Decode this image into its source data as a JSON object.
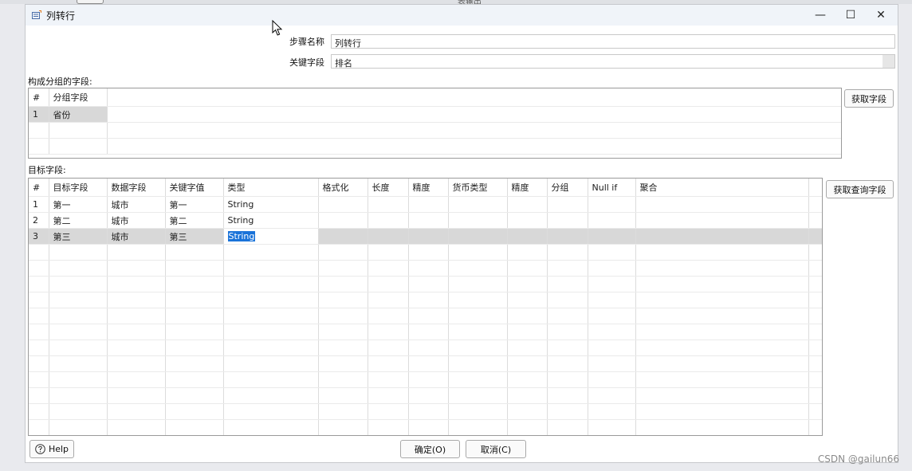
{
  "window": {
    "title": "列转行",
    "minimize_glyph": "—",
    "maximize_glyph": "☐",
    "close_glyph": "✕"
  },
  "background_label": "表输出",
  "form": {
    "step_name_label": "步骤名称",
    "step_name_value": "列转行",
    "key_field_label": "关键字段",
    "key_field_value": "排名"
  },
  "group_section": {
    "label": "构成分组的字段:",
    "header_idx": "#",
    "header_field": "分组字段",
    "rows": [
      {
        "idx": "1",
        "field": "省份"
      }
    ],
    "get_fields_button": "获取字段"
  },
  "target_section": {
    "label": "目标字段:",
    "headers": [
      "#",
      "目标字段",
      "数据字段",
      "关键字值",
      "类型",
      "格式化",
      "长度",
      "精度",
      "货币类型",
      "精度",
      "分组",
      "Null if",
      "聚合"
    ],
    "rows": [
      [
        "1",
        "第一",
        "城市",
        "第一",
        "String",
        "",
        "",
        "",
        "",
        "",
        "",
        "",
        ""
      ],
      [
        "2",
        "第二",
        "城市",
        "第二",
        "String",
        "",
        "",
        "",
        "",
        "",
        "",
        "",
        ""
      ],
      [
        "3",
        "第三",
        "城市",
        "第三",
        "String",
        "",
        "",
        "",
        "",
        "",
        "",
        "",
        ""
      ]
    ],
    "get_lookup_fields_button": "获取查询字段"
  },
  "footer": {
    "help_label": "Help",
    "ok_label": "确定(O)",
    "cancel_label": "取消(C)"
  },
  "watermark": "CSDN @gailun66"
}
